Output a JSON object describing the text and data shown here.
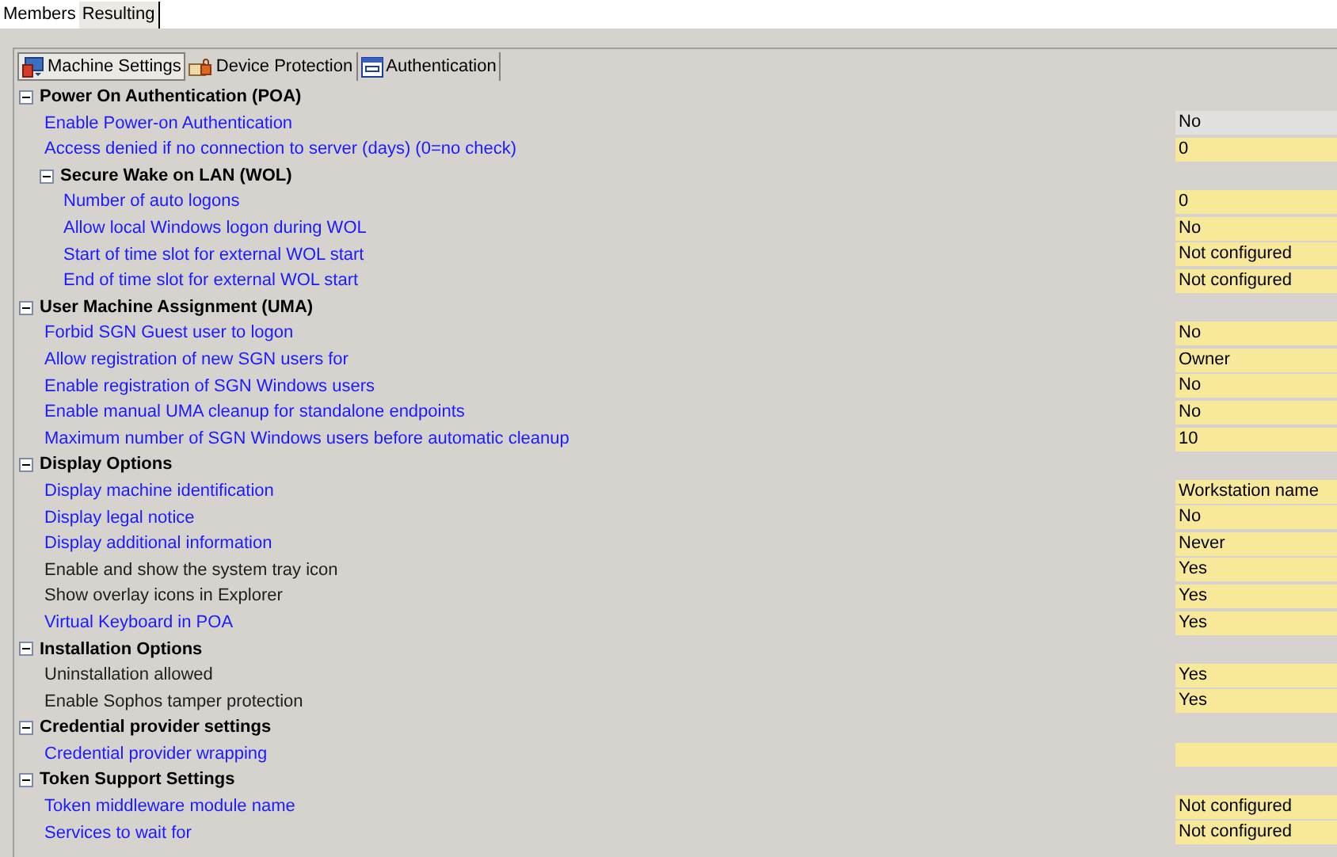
{
  "top_tabs": [
    {
      "label": "Members",
      "selected": false
    },
    {
      "label": "Resulting",
      "selected": true
    }
  ],
  "tabs": [
    {
      "label": "Machine Settings",
      "kind": "computer",
      "selected": true
    },
    {
      "label": "Device Protection",
      "kind": "lock",
      "selected": false
    },
    {
      "label": "Authentication",
      "kind": "window",
      "selected": false
    }
  ],
  "tree": [
    {
      "kind": "group",
      "label": "Power On Authentication (POA)",
      "expanded": true,
      "children": [
        {
          "kind": "setting",
          "label": "Enable Power-on Authentication",
          "value": "No",
          "defined": true,
          "selected": true
        },
        {
          "kind": "setting",
          "label": "Access denied if no connection to server (days) (0=no check)",
          "value": "0",
          "defined": true,
          "selected": false
        },
        {
          "kind": "group",
          "label": "Secure Wake on LAN (WOL)",
          "expanded": true,
          "children": [
            {
              "kind": "setting",
              "label": "Number of auto logons",
              "value": "0",
              "defined": true,
              "selected": false
            },
            {
              "kind": "setting",
              "label": "Allow local Windows logon during WOL",
              "value": "No",
              "defined": true,
              "selected": false
            },
            {
              "kind": "setting",
              "label": "Start of time slot for external WOL start",
              "value": "Not configured",
              "defined": true,
              "selected": false
            },
            {
              "kind": "setting",
              "label": "End of time slot for external WOL start",
              "value": "Not configured",
              "defined": true,
              "selected": false
            }
          ]
        }
      ]
    },
    {
      "kind": "group",
      "label": "User Machine Assignment (UMA)",
      "expanded": true,
      "children": [
        {
          "kind": "setting",
          "label": "Forbid SGN Guest user to logon",
          "value": "No",
          "defined": true,
          "selected": false
        },
        {
          "kind": "setting",
          "label": "Allow registration of new SGN users for",
          "value": "Owner",
          "defined": true,
          "selected": false
        },
        {
          "kind": "setting",
          "label": "Enable registration of SGN Windows users",
          "value": "No",
          "defined": true,
          "selected": false
        },
        {
          "kind": "setting",
          "label": "Enable manual UMA cleanup for standalone endpoints",
          "value": "No",
          "defined": true,
          "selected": false
        },
        {
          "kind": "setting",
          "label": "Maximum number of SGN Windows users before automatic cleanup",
          "value": "10",
          "defined": true,
          "selected": false
        }
      ]
    },
    {
      "kind": "group",
      "label": "Display Options",
      "expanded": true,
      "children": [
        {
          "kind": "setting",
          "label": "Display machine identification",
          "value": "Workstation name",
          "defined": true,
          "selected": false
        },
        {
          "kind": "setting",
          "label": "Display legal notice",
          "value": "No",
          "defined": true,
          "selected": false
        },
        {
          "kind": "setting",
          "label": "Display additional information",
          "value": "Never",
          "defined": true,
          "selected": false
        },
        {
          "kind": "setting",
          "label": "Enable and show the system tray icon",
          "value": "Yes",
          "defined": false,
          "selected": false
        },
        {
          "kind": "setting",
          "label": "Show overlay icons in Explorer",
          "value": "Yes",
          "defined": false,
          "selected": false
        },
        {
          "kind": "setting",
          "label": "Virtual Keyboard in POA",
          "value": "Yes",
          "defined": true,
          "selected": false
        }
      ]
    },
    {
      "kind": "group",
      "label": "Installation Options",
      "expanded": true,
      "children": [
        {
          "kind": "setting",
          "label": "Uninstallation allowed",
          "value": "Yes",
          "defined": false,
          "selected": false
        },
        {
          "kind": "setting",
          "label": "Enable Sophos tamper protection",
          "value": "Yes",
          "defined": false,
          "selected": false
        }
      ]
    },
    {
      "kind": "group",
      "label": "Credential provider settings",
      "expanded": true,
      "children": [
        {
          "kind": "setting",
          "label": "Credential provider wrapping",
          "defined": true,
          "selected": false
        }
      ]
    },
    {
      "kind": "group",
      "label": "Token Support Settings",
      "expanded": true,
      "children": [
        {
          "kind": "setting",
          "label": "Token middleware module name",
          "value": "Not configured",
          "defined": true,
          "selected": false
        },
        {
          "kind": "setting",
          "label": "Services to wait for",
          "value": "Not configured",
          "defined": true,
          "selected": false
        }
      ]
    }
  ]
}
